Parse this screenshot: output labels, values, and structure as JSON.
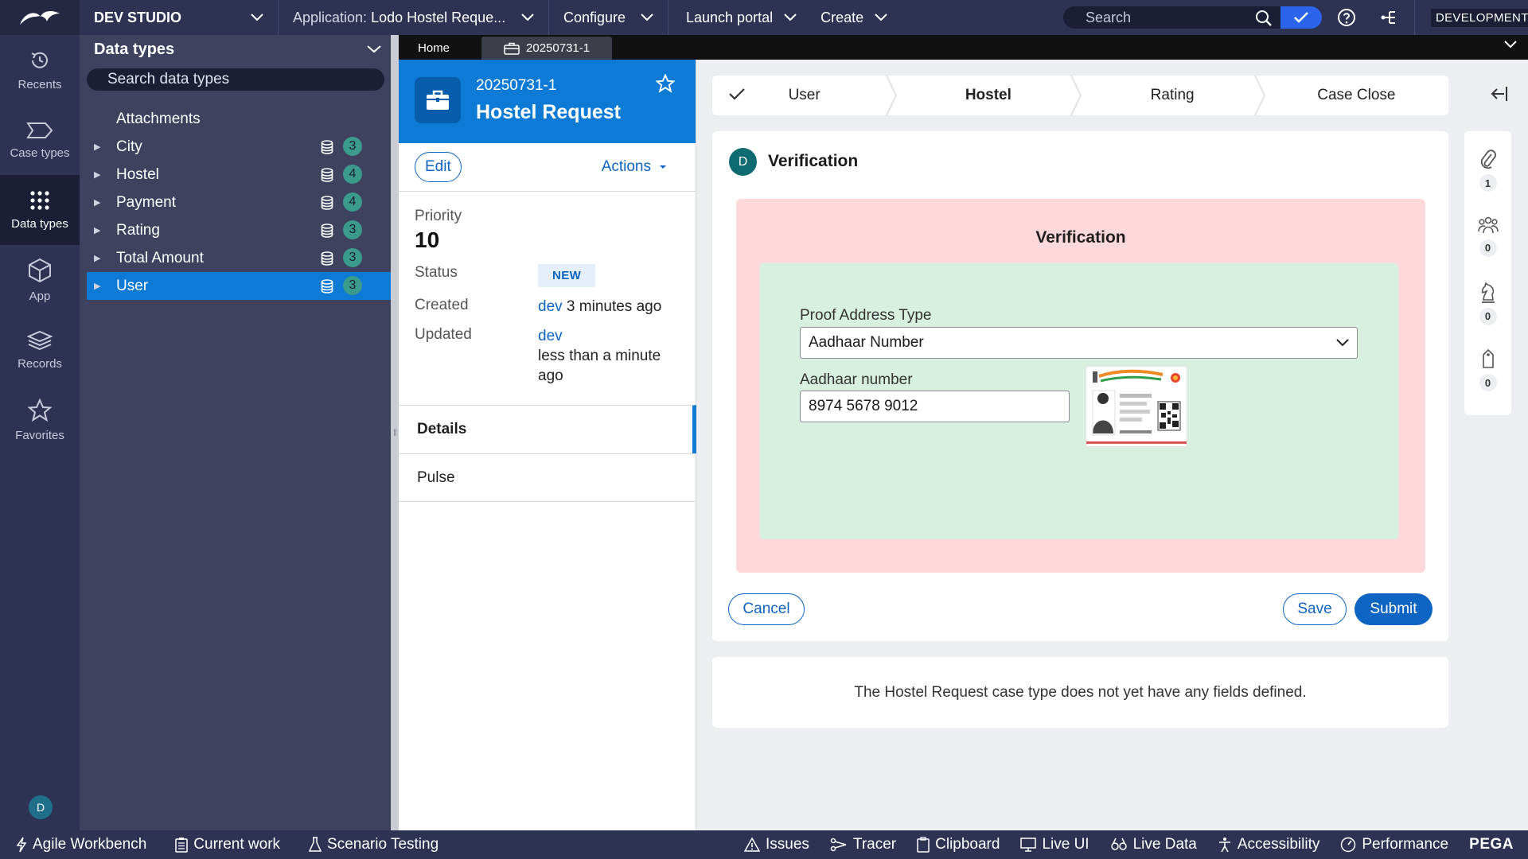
{
  "topbar": {
    "studio_label": "DEV STUDIO",
    "application_label": "Application:",
    "application_value": "Lodo Hostel Reque...",
    "configure_label": "Configure",
    "launch_portal_label": "Launch portal",
    "create_label": "Create",
    "search_placeholder": "Search",
    "environment_badge": "DEVELOPMENT"
  },
  "leftnav": {
    "items": [
      {
        "label": "Recents",
        "icon": "history-icon"
      },
      {
        "label": "Case types",
        "icon": "case-types-icon"
      },
      {
        "label": "Data types",
        "icon": "grid-dots-icon"
      },
      {
        "label": "App",
        "icon": "cube-icon"
      },
      {
        "label": "Records",
        "icon": "layers-icon"
      },
      {
        "label": "Favorites",
        "icon": "star-icon"
      }
    ],
    "active": "Data types",
    "user_initial": "D"
  },
  "explorer": {
    "title": "Data types",
    "search_placeholder": "Search data types",
    "items": [
      {
        "name": "Attachments",
        "count": ""
      },
      {
        "name": "City",
        "count": "3"
      },
      {
        "name": "Hostel",
        "count": "4"
      },
      {
        "name": "Payment",
        "count": "4"
      },
      {
        "name": "Rating",
        "count": "3"
      },
      {
        "name": "Total Amount",
        "count": "3"
      },
      {
        "name": "User",
        "count": "3"
      }
    ],
    "selected": "User"
  },
  "tabs": {
    "home_label": "Home",
    "case_tab_label": "20250731-1"
  },
  "case_summary": {
    "case_id": "20250731-1",
    "case_title": "Hostel Request",
    "edit_label": "Edit",
    "actions_label": "Actions",
    "priority_label": "Priority",
    "priority_value": "10",
    "status_label": "Status",
    "status_value": "NEW",
    "created_label": "Created",
    "created_by": "dev",
    "created_when": "3 minutes ago",
    "updated_label": "Updated",
    "updated_by": "dev",
    "updated_when": "less than a minute ago",
    "tabs": [
      "Details",
      "Pulse"
    ]
  },
  "stages": {
    "items": [
      "User",
      "Hostel",
      "Rating",
      "Case Close"
    ],
    "completed": "User",
    "current": "Hostel"
  },
  "assignment": {
    "avatar_initial": "D",
    "title": "Verification",
    "section_title": "Verification",
    "proof_type_label": "Proof Address Type",
    "proof_type_value": "Aadhaar Number",
    "aadhaar_label": "Aadhaar number",
    "aadhaar_value": "8974 5678 9012",
    "cancel_label": "Cancel",
    "save_label": "Save",
    "submit_label": "Submit"
  },
  "info_message": "The Hostel Request case type does not yet have any fields defined.",
  "rail": {
    "items": [
      {
        "icon": "paperclip-icon",
        "count": "1"
      },
      {
        "icon": "followers-icon",
        "count": "0"
      },
      {
        "icon": "chess-knight-icon",
        "count": "0"
      },
      {
        "icon": "tag-icon",
        "count": "0"
      }
    ]
  },
  "devbar": {
    "left": [
      "Agile Workbench",
      "Current work",
      "Scenario Testing"
    ],
    "right": [
      "Issues",
      "Tracer",
      "Clipboard",
      "Live UI",
      "Live Data",
      "Accessibility",
      "Performance"
    ],
    "brand": "PEGA"
  },
  "colors": {
    "chrome": "#2e3354",
    "accent": "#0d7bd6",
    "primary_button": "#0d64c2",
    "section_pink": "#fed8db",
    "section_green": "#d8f0e0"
  }
}
